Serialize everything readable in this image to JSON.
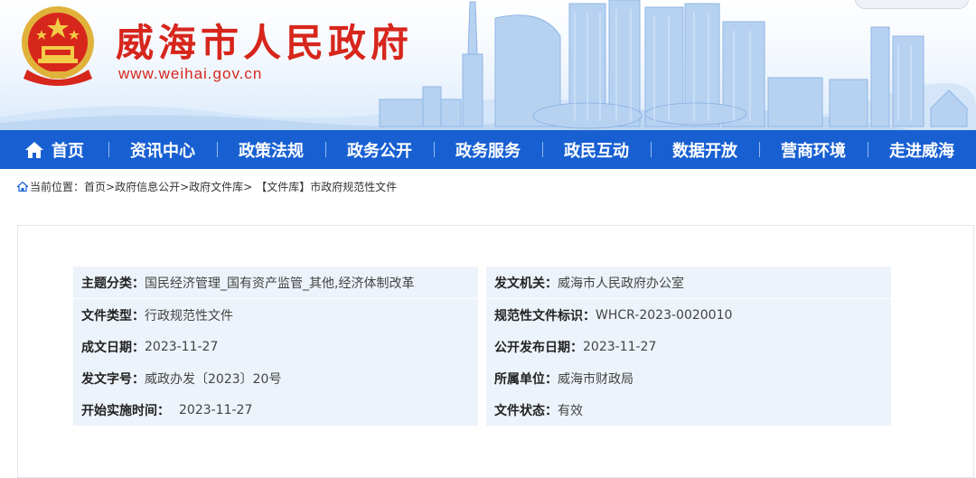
{
  "header": {
    "site_title": "威海市人民政府",
    "site_url": "www.weihai.gov.cn"
  },
  "nav": {
    "items": [
      {
        "label": "首页",
        "icon": "home-icon"
      },
      {
        "label": "资讯中心"
      },
      {
        "label": "政策法规"
      },
      {
        "label": "政务公开"
      },
      {
        "label": "政务服务"
      },
      {
        "label": "政民互动"
      },
      {
        "label": "数据开放"
      },
      {
        "label": "营商环境"
      },
      {
        "label": "走进威海"
      }
    ]
  },
  "breadcrumb": {
    "icon": "location-home-icon",
    "prefix": "当前位置：",
    "items": [
      "首页",
      "政府信息公开",
      "政府文件库",
      "【文件库】市政府规范性文件"
    ],
    "separator": ">"
  },
  "document_meta": {
    "rows": [
      {
        "left": {
          "key": "主题分类：",
          "value": "国民经济管理_国有资产监管_其他,经济体制改革"
        },
        "right": {
          "key": "发文机关：",
          "value": "威海市人民政府办公室"
        }
      },
      {
        "left": {
          "key": "文件类型：",
          "value": "行政规范性文件"
        },
        "right": {
          "key": "规范性文件标识：",
          "value": "WHCR-2023-0020010"
        }
      },
      {
        "left": {
          "key": "成文日期：",
          "value": "2023-11-27"
        },
        "right": {
          "key": "公开发布日期：",
          "value": "2023-11-27"
        }
      },
      {
        "left": {
          "key": "发文字号：",
          "value": "威政办发〔2023〕20号"
        },
        "right": {
          "key": "所属单位：",
          "value": "威海市财政局"
        }
      },
      {
        "left": {
          "key": "开始实施时间：",
          "value": "2023-11-27"
        },
        "right": {
          "key": "文件状态：",
          "value": "有效"
        }
      }
    ]
  },
  "colors": {
    "nav_bg": "#1860d2",
    "title_red": "#d7261c",
    "meta_row_bg": "#edf3fa"
  }
}
